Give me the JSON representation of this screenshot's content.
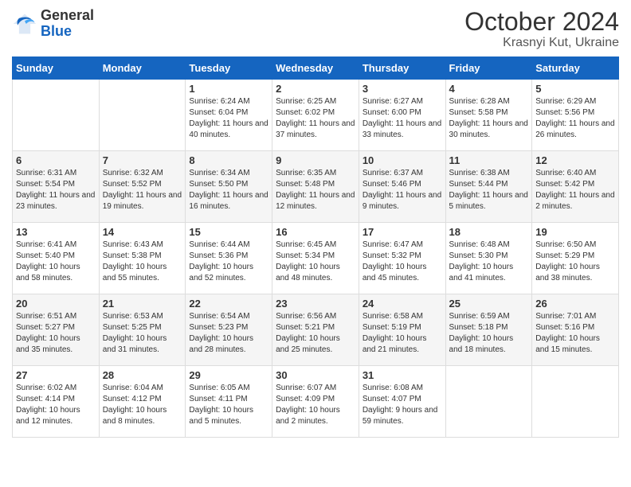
{
  "logo": {
    "general": "General",
    "blue": "Blue"
  },
  "title": "October 2024",
  "subtitle": "Krasnyi Kut, Ukraine",
  "days_of_week": [
    "Sunday",
    "Monday",
    "Tuesday",
    "Wednesday",
    "Thursday",
    "Friday",
    "Saturday"
  ],
  "weeks": [
    [
      {
        "day": "",
        "info": ""
      },
      {
        "day": "",
        "info": ""
      },
      {
        "day": "1",
        "info": "Sunrise: 6:24 AM\nSunset: 6:04 PM\nDaylight: 11 hours and 40 minutes."
      },
      {
        "day": "2",
        "info": "Sunrise: 6:25 AM\nSunset: 6:02 PM\nDaylight: 11 hours and 37 minutes."
      },
      {
        "day": "3",
        "info": "Sunrise: 6:27 AM\nSunset: 6:00 PM\nDaylight: 11 hours and 33 minutes."
      },
      {
        "day": "4",
        "info": "Sunrise: 6:28 AM\nSunset: 5:58 PM\nDaylight: 11 hours and 30 minutes."
      },
      {
        "day": "5",
        "info": "Sunrise: 6:29 AM\nSunset: 5:56 PM\nDaylight: 11 hours and 26 minutes."
      }
    ],
    [
      {
        "day": "6",
        "info": "Sunrise: 6:31 AM\nSunset: 5:54 PM\nDaylight: 11 hours and 23 minutes."
      },
      {
        "day": "7",
        "info": "Sunrise: 6:32 AM\nSunset: 5:52 PM\nDaylight: 11 hours and 19 minutes."
      },
      {
        "day": "8",
        "info": "Sunrise: 6:34 AM\nSunset: 5:50 PM\nDaylight: 11 hours and 16 minutes."
      },
      {
        "day": "9",
        "info": "Sunrise: 6:35 AM\nSunset: 5:48 PM\nDaylight: 11 hours and 12 minutes."
      },
      {
        "day": "10",
        "info": "Sunrise: 6:37 AM\nSunset: 5:46 PM\nDaylight: 11 hours and 9 minutes."
      },
      {
        "day": "11",
        "info": "Sunrise: 6:38 AM\nSunset: 5:44 PM\nDaylight: 11 hours and 5 minutes."
      },
      {
        "day": "12",
        "info": "Sunrise: 6:40 AM\nSunset: 5:42 PM\nDaylight: 11 hours and 2 minutes."
      }
    ],
    [
      {
        "day": "13",
        "info": "Sunrise: 6:41 AM\nSunset: 5:40 PM\nDaylight: 10 hours and 58 minutes."
      },
      {
        "day": "14",
        "info": "Sunrise: 6:43 AM\nSunset: 5:38 PM\nDaylight: 10 hours and 55 minutes."
      },
      {
        "day": "15",
        "info": "Sunrise: 6:44 AM\nSunset: 5:36 PM\nDaylight: 10 hours and 52 minutes."
      },
      {
        "day": "16",
        "info": "Sunrise: 6:45 AM\nSunset: 5:34 PM\nDaylight: 10 hours and 48 minutes."
      },
      {
        "day": "17",
        "info": "Sunrise: 6:47 AM\nSunset: 5:32 PM\nDaylight: 10 hours and 45 minutes."
      },
      {
        "day": "18",
        "info": "Sunrise: 6:48 AM\nSunset: 5:30 PM\nDaylight: 10 hours and 41 minutes."
      },
      {
        "day": "19",
        "info": "Sunrise: 6:50 AM\nSunset: 5:29 PM\nDaylight: 10 hours and 38 minutes."
      }
    ],
    [
      {
        "day": "20",
        "info": "Sunrise: 6:51 AM\nSunset: 5:27 PM\nDaylight: 10 hours and 35 minutes."
      },
      {
        "day": "21",
        "info": "Sunrise: 6:53 AM\nSunset: 5:25 PM\nDaylight: 10 hours and 31 minutes."
      },
      {
        "day": "22",
        "info": "Sunrise: 6:54 AM\nSunset: 5:23 PM\nDaylight: 10 hours and 28 minutes."
      },
      {
        "day": "23",
        "info": "Sunrise: 6:56 AM\nSunset: 5:21 PM\nDaylight: 10 hours and 25 minutes."
      },
      {
        "day": "24",
        "info": "Sunrise: 6:58 AM\nSunset: 5:19 PM\nDaylight: 10 hours and 21 minutes."
      },
      {
        "day": "25",
        "info": "Sunrise: 6:59 AM\nSunset: 5:18 PM\nDaylight: 10 hours and 18 minutes."
      },
      {
        "day": "26",
        "info": "Sunrise: 7:01 AM\nSunset: 5:16 PM\nDaylight: 10 hours and 15 minutes."
      }
    ],
    [
      {
        "day": "27",
        "info": "Sunrise: 6:02 AM\nSunset: 4:14 PM\nDaylight: 10 hours and 12 minutes."
      },
      {
        "day": "28",
        "info": "Sunrise: 6:04 AM\nSunset: 4:12 PM\nDaylight: 10 hours and 8 minutes."
      },
      {
        "day": "29",
        "info": "Sunrise: 6:05 AM\nSunset: 4:11 PM\nDaylight: 10 hours and 5 minutes."
      },
      {
        "day": "30",
        "info": "Sunrise: 6:07 AM\nSunset: 4:09 PM\nDaylight: 10 hours and 2 minutes."
      },
      {
        "day": "31",
        "info": "Sunrise: 6:08 AM\nSunset: 4:07 PM\nDaylight: 9 hours and 59 minutes."
      },
      {
        "day": "",
        "info": ""
      },
      {
        "day": "",
        "info": ""
      }
    ]
  ]
}
